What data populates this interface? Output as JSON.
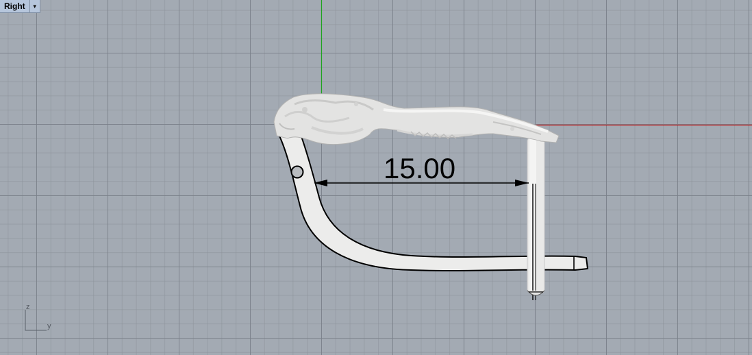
{
  "viewport": {
    "title": "Right",
    "dropdown_icon": "triangle-down-icon"
  },
  "axis_widget": {
    "vertical_axis_label": "z",
    "horizontal_axis_label": "y"
  },
  "dimension": {
    "value": "15.00"
  },
  "colors": {
    "background": "#a3aab3",
    "grid_major": "#7a8089",
    "grid_minor": "#8c929a",
    "world_axis_vertical": "#1fa31f",
    "world_axis_horizontal": "#c01818",
    "model_fill": "#ececeb",
    "outline": "#000000",
    "title_tab": "#b6c6dc"
  }
}
